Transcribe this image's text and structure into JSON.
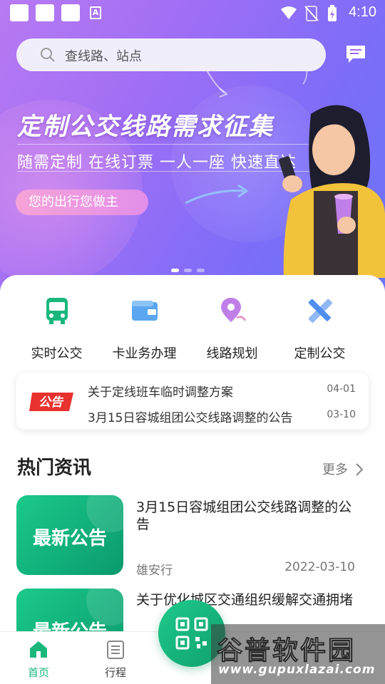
{
  "status_bar": {
    "time": "4:10"
  },
  "search": {
    "placeholder": "查线路、站点"
  },
  "banner": {
    "title": "定制公交线路需求征集",
    "subtitle": "随需定制  在线订票  一人一座  快速直达",
    "pill": "您的出行您做主",
    "page_count": 3,
    "active_page": 1
  },
  "quick_actions": [
    {
      "label": "实时公交",
      "icon": "bus-icon"
    },
    {
      "label": "卡业务办理",
      "icon": "card-wallet-icon"
    },
    {
      "label": "线路规划",
      "icon": "route-pin-icon"
    },
    {
      "label": "定制公交",
      "icon": "ruler-pencil-icon"
    }
  ],
  "notices": {
    "badge": "公告",
    "items": [
      {
        "title": "关于定线班车临时调整方案",
        "date": "04-01"
      },
      {
        "title": "3月15日容城组团公交线路调整的公告",
        "date": "03-10"
      }
    ]
  },
  "hot_news": {
    "title": "热门资讯",
    "more": "更多",
    "items": [
      {
        "thumb_text": "最新公告",
        "title": "3月15日容城组团公交线路调整的公告",
        "source": "雄安行",
        "date": "2022-03-10"
      },
      {
        "thumb_text": "最新公告",
        "title": "关于优化城区交通组织缓解交通拥堵",
        "source": "",
        "date": ""
      }
    ]
  },
  "bottom_nav": [
    {
      "label": "首页",
      "active": true
    },
    {
      "label": "行程",
      "active": false
    }
  ],
  "watermark": {
    "main": "谷普软件园",
    "url": "www.gupuxlazai.com"
  },
  "colors": {
    "accent_green": "#1ab77d",
    "banner_purple": "#9f6ef5"
  }
}
